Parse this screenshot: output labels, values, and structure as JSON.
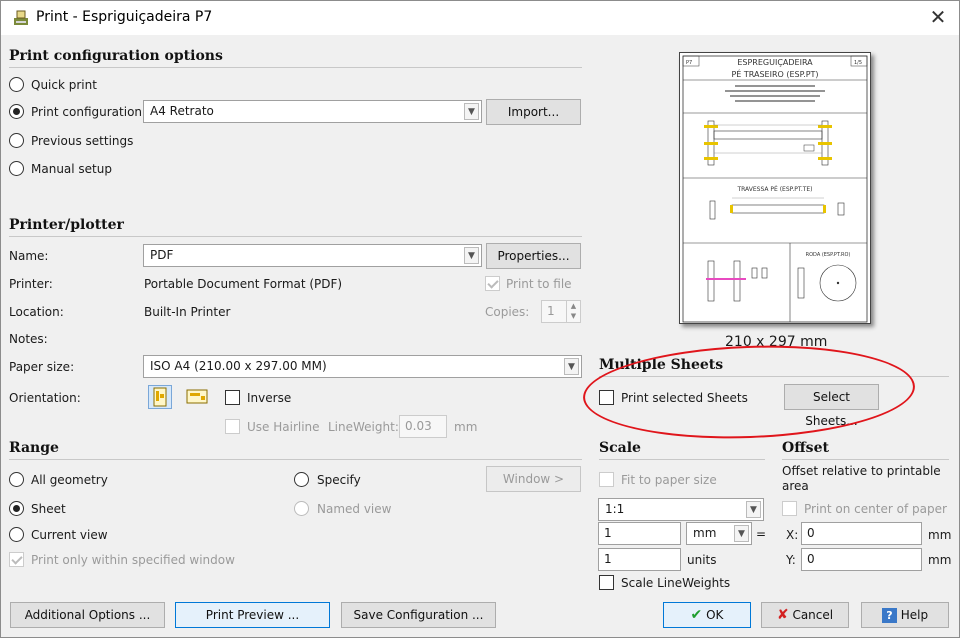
{
  "window": {
    "title": "Print - Espriguiçadeira P7",
    "close": "✕"
  },
  "print_config": {
    "heading": "Print configuration options",
    "quick_print": "Quick print",
    "print_configuration": "Print configuration:",
    "configuration_value": "A4 Retrato",
    "import_label": "Import...",
    "previous_settings": "Previous settings",
    "manual_setup": "Manual setup"
  },
  "printer": {
    "heading": "Printer/plotter",
    "name_label": "Name:",
    "name_value": "PDF",
    "properties_label": "Properties...",
    "printer_label": "Printer:",
    "printer_value": "Portable Document Format (PDF)",
    "print_to_file": "Print to file",
    "location_label": "Location:",
    "location_value": "Built-In Printer",
    "copies_label": "Copies:",
    "copies_value": "1",
    "notes_label": "Notes:",
    "paper_size_label": "Paper size:",
    "paper_size_value": "ISO A4 (210.00 x 297.00 MM)",
    "orientation_label": "Orientation:",
    "inverse": "Inverse",
    "use_hairline": "Use Hairline",
    "lineweight_label": "LineWeight:",
    "lineweight_value": "0.03",
    "lineweight_unit": "mm"
  },
  "range": {
    "heading": "Range",
    "all_geometry": "All geometry",
    "specify": "Specify",
    "window_label": "Window >",
    "sheet": "Sheet",
    "named_view": "Named view",
    "current_view": "Current view",
    "only_within_window": "Print only within specified window"
  },
  "preview": {
    "size_text": "210 x 297 mm",
    "sheet_code": "P7",
    "sheet_index": "1/5",
    "title_line1": "ESPREGUIÇADEIRA",
    "title_line2": "PÉ TRASEIRO (ESP.PT)",
    "section_traversa": "TRAVESSA PÉ (ESP.PT.TE)",
    "section_roda": "RODA (ESP.PT.RO)"
  },
  "multiple_sheets": {
    "heading": "Multiple Sheets",
    "print_selected": "Print selected Sheets",
    "select_sheets": "Select Sheets..."
  },
  "scale": {
    "heading": "Scale",
    "fit_to_paper": "Fit to paper size",
    "ratio_value": "1:1",
    "mm_value": "1",
    "mm_unit": "mm",
    "equals": "=",
    "units_value": "1",
    "units_label": "units",
    "scale_lineweights": "Scale LineWeights"
  },
  "offset": {
    "heading": "Offset",
    "description": "Offset relative to printable area",
    "print_center": "Print on center of paper",
    "x_label": "X:",
    "x_value": "0",
    "y_label": "Y:",
    "y_value": "0",
    "unit": "mm"
  },
  "footer": {
    "additional_options": "Additional Options ...",
    "print_preview": "Print Preview ...",
    "save_configuration": "Save Configuration ...",
    "ok": "OK",
    "cancel": "Cancel",
    "help": "Help"
  },
  "colors": {
    "annotation_red": "#e0151b",
    "accent_blue": "#0078d7",
    "ok_green": "#1e9e2e",
    "cancel_red": "#d32020"
  }
}
